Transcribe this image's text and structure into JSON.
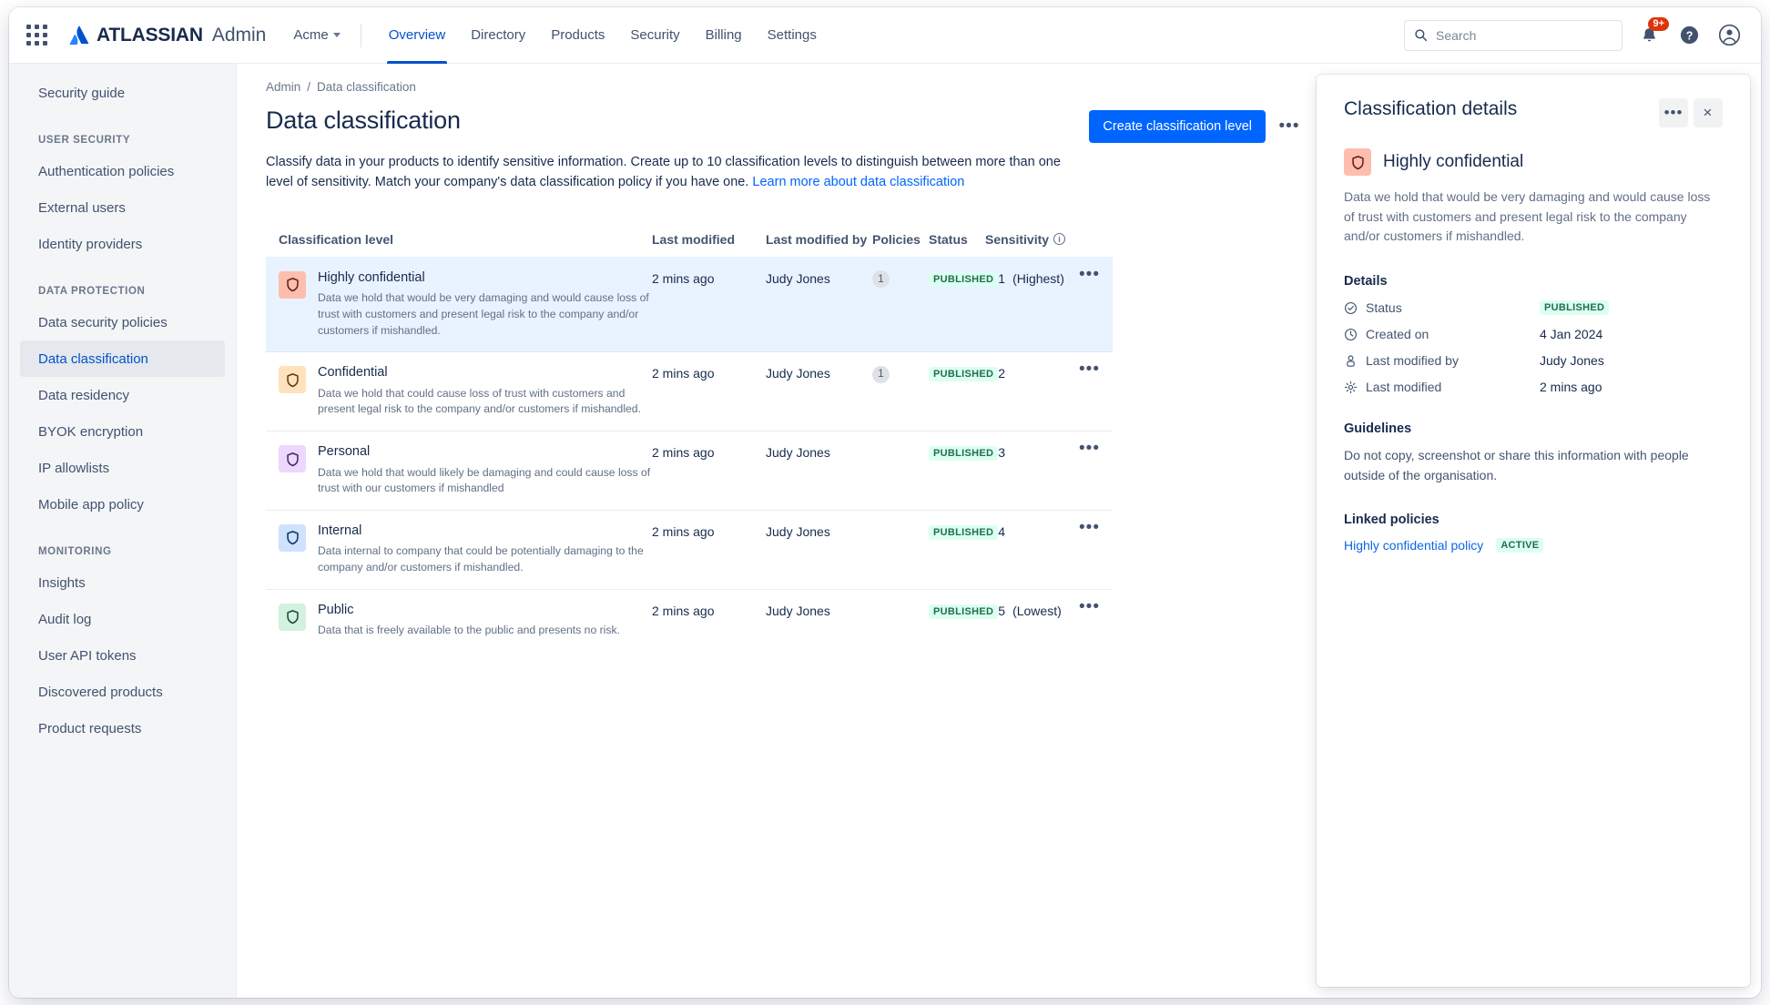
{
  "topnav": {
    "apps_icon": "apps-grid-icon",
    "brand_primary": "ATLASSIAN",
    "brand_secondary": "Admin",
    "org": "Acme",
    "items": [
      {
        "label": "Overview",
        "active": true
      },
      {
        "label": "Directory",
        "active": false
      },
      {
        "label": "Products",
        "active": false
      },
      {
        "label": "Security",
        "active": false
      },
      {
        "label": "Billing",
        "active": false
      },
      {
        "label": "Settings",
        "active": false
      }
    ],
    "search_placeholder": "Search",
    "notification_badge": "9+",
    "icons": [
      "search-icon",
      "notifications-icon",
      "help-icon",
      "account-avatar-icon"
    ]
  },
  "sidebar": {
    "top_item": "Security guide",
    "groups": [
      {
        "title": "USER SECURITY",
        "items": [
          {
            "label": "Authentication policies",
            "active": false
          },
          {
            "label": "External users",
            "active": false
          },
          {
            "label": "Identity providers",
            "active": false
          }
        ]
      },
      {
        "title": "DATA PROTECTION",
        "items": [
          {
            "label": "Data security policies",
            "active": false
          },
          {
            "label": "Data classification",
            "active": true
          },
          {
            "label": "Data residency",
            "active": false
          },
          {
            "label": "BYOK encryption",
            "active": false
          },
          {
            "label": "IP allowlists",
            "active": false
          },
          {
            "label": "Mobile app policy",
            "active": false
          }
        ]
      },
      {
        "title": "MONITORING",
        "items": [
          {
            "label": "Insights",
            "active": false
          },
          {
            "label": "Audit log",
            "active": false
          },
          {
            "label": "User API tokens",
            "active": false
          },
          {
            "label": "Discovered products",
            "active": false
          },
          {
            "label": "Product requests",
            "active": false
          }
        ]
      }
    ]
  },
  "main": {
    "breadcrumb": {
      "root": "Admin",
      "separator": "/",
      "current": "Data classification"
    },
    "title": "Data classification",
    "description": "Classify data in your products to identify sensitive information. Create up to 10 classification levels to distinguish between more than one level of sensitivity. Match your company's data classification policy if you have one.",
    "description_link": "Learn more about data classification",
    "create_button": "Create classification level",
    "more_button": "•••",
    "table": {
      "columns": [
        "Classification level",
        "Last modified",
        "Last modified by",
        "Policies",
        "Status",
        "Sensitivity"
      ],
      "rows": [
        {
          "name": "Highly confidential",
          "desc": "Data we hold that would be very damaging and would cause loss of trust with customers and present legal risk to the company and/or customers if mishandled.",
          "last_modified": "2 mins ago",
          "last_modified_by": "Judy Jones",
          "policies": "1",
          "status": "PUBLISHED",
          "sensitivity": "1",
          "sensitivity_qualifier": "(Highest)",
          "chip_bg": "#FFBDAD",
          "chip_fg": "#5D1F1A",
          "selected": true
        },
        {
          "name": "Confidential",
          "desc": "Data we hold that could cause loss of trust with customers and present legal risk to the company and/or customers if mishandled.",
          "last_modified": "2 mins ago",
          "last_modified_by": "Judy Jones",
          "policies": "1",
          "status": "PUBLISHED",
          "sensitivity": "2",
          "sensitivity_qualifier": "",
          "chip_bg": "#FFE2BD",
          "chip_fg": "#5E3A05",
          "selected": false
        },
        {
          "name": "Personal",
          "desc": "Data we hold that would likely be damaging and could cause loss of trust with our customers if mishandled",
          "last_modified": "2 mins ago",
          "last_modified_by": "Judy Jones",
          "policies": "",
          "status": "PUBLISHED",
          "sensitivity": "3",
          "sensitivity_qualifier": "",
          "chip_bg": "#EED7FC",
          "chip_fg": "#352C63",
          "selected": false
        },
        {
          "name": "Internal",
          "desc": "Data internal to company that could be potentially damaging to the company and/or customers if mishandled.",
          "last_modified": "2 mins ago",
          "last_modified_by": "Judy Jones",
          "policies": "",
          "status": "PUBLISHED",
          "sensitivity": "4",
          "sensitivity_qualifier": "",
          "chip_bg": "#CFE1FD",
          "chip_fg": "#09326C",
          "selected": false
        },
        {
          "name": "Public",
          "desc": "Data that is freely available to the public and presents no risk.",
          "last_modified": "2 mins ago",
          "last_modified_by": "Judy Jones",
          "policies": "",
          "status": "PUBLISHED",
          "sensitivity": "5",
          "sensitivity_qualifier": "(Lowest)",
          "chip_bg": "#D3F1DF",
          "chip_fg": "#164B35",
          "selected": false
        }
      ]
    }
  },
  "panel": {
    "title": "Classification details",
    "more_button": "•••",
    "close_button": "×",
    "level_name": "Highly confidential",
    "level_chip_bg": "#FFBDAD",
    "level_chip_fg": "#5D1F1A",
    "level_desc": "Data we hold that would be very damaging and would cause loss of trust with customers and present legal risk to the company and/or customers if mishandled.",
    "details_heading": "Details",
    "details": [
      {
        "icon": "check-circle-icon",
        "label": "Status",
        "value": "PUBLISHED",
        "is_lozenge": true
      },
      {
        "icon": "clock-icon",
        "label": "Created on",
        "value": "4 Jan 2024",
        "is_lozenge": false
      },
      {
        "icon": "person-icon",
        "label": "Last modified by",
        "value": "Judy Jones",
        "is_lozenge": false
      },
      {
        "icon": "gear-icon",
        "label": "Last modified",
        "value": "2 mins ago",
        "is_lozenge": false
      }
    ],
    "guidelines_heading": "Guidelines",
    "guidelines_text": "Do not copy, screenshot or share this information with people outside of the organisation.",
    "linked_heading": "Linked policies",
    "linked_policy": "Highly confidential policy",
    "linked_status": "ACTIVE"
  },
  "colors": {
    "brand_blue": "#0052CC",
    "button_blue": "#0065FF",
    "link_blue": "#0C66E4",
    "selected_row": "#E9F2FF",
    "success_bg": "#DCFFF1",
    "success_fg": "#216E4E",
    "danger_red": "#DE350B"
  }
}
